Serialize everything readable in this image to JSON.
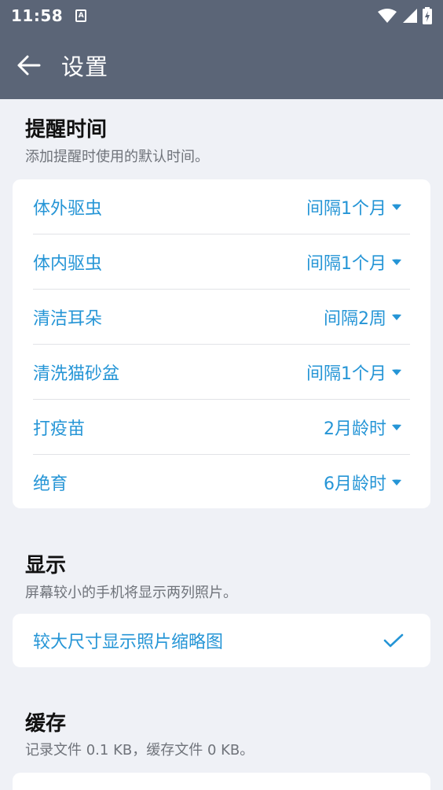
{
  "status": {
    "time": "11:58",
    "notif_glyph": "A"
  },
  "appbar": {
    "title": "设置"
  },
  "reminder": {
    "title": "提醒时间",
    "subtitle": "添加提醒时使用的默认时间。",
    "items": [
      {
        "label": "体外驱虫",
        "value": "间隔1个月"
      },
      {
        "label": "体内驱虫",
        "value": "间隔1个月"
      },
      {
        "label": "清洁耳朵",
        "value": "间隔2周"
      },
      {
        "label": "清洗猫砂盆",
        "value": "间隔1个月"
      },
      {
        "label": "打疫苗",
        "value": "2月龄时"
      },
      {
        "label": "绝育",
        "value": "6月龄时"
      }
    ]
  },
  "display": {
    "title": "显示",
    "subtitle": "屏幕较小的手机将显示两列照片。",
    "option_label": "较大尺寸显示照片缩略图",
    "option_checked": true
  },
  "cache": {
    "title": "缓存",
    "subtitle": "记录文件 0.1 KB，缓存文件 0 KB。"
  },
  "colors": {
    "header": "#5b6577",
    "accent": "#2595d6",
    "background": "#eff1f6"
  },
  "icons": [
    "back-arrow-icon",
    "wifi-icon",
    "signal-icon",
    "battery-icon",
    "caret-down-icon",
    "checkmark-icon"
  ]
}
